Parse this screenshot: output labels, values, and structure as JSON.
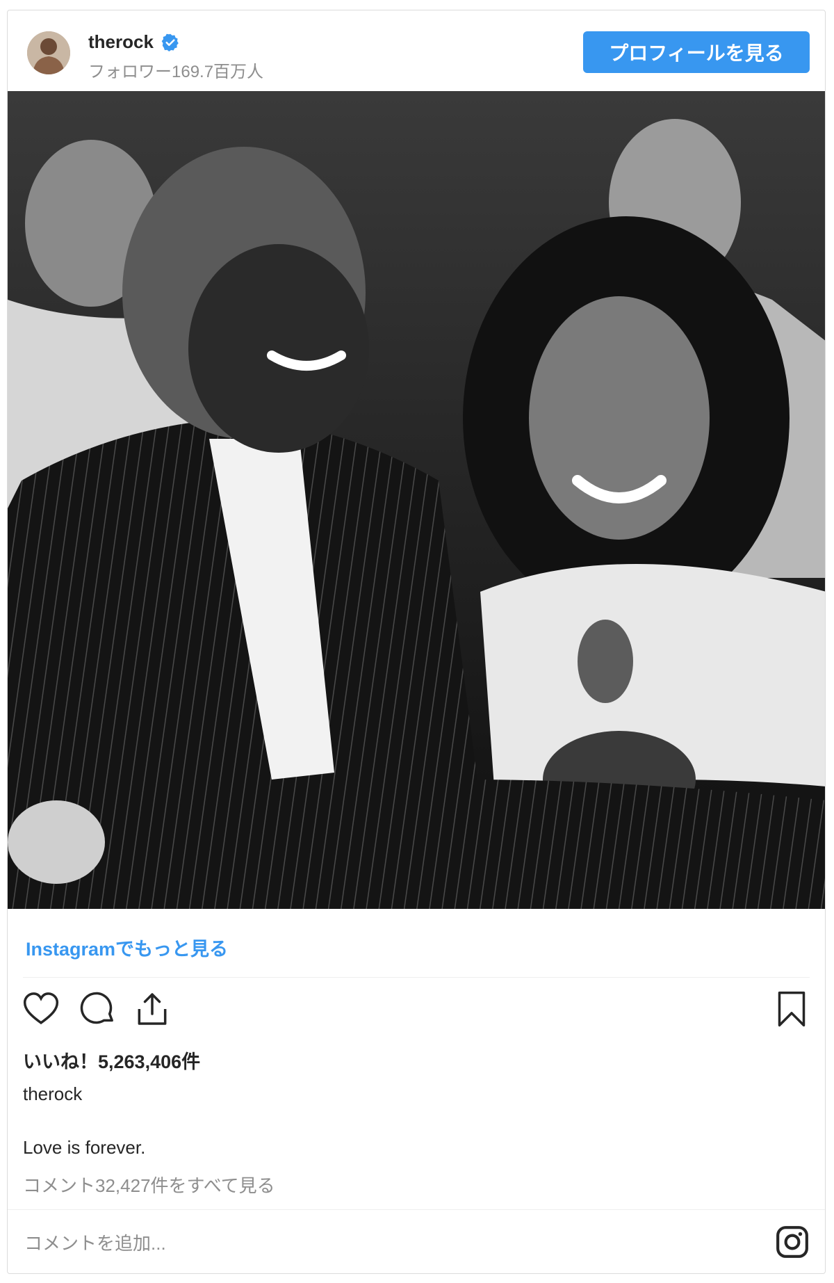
{
  "post": {
    "username": "therock",
    "followers": "フォロワー169.7百万人",
    "profile_button": "プロフィールを見る",
    "more_on_instagram": "Instagramでもっと見る",
    "likes": "いいね！5,263,406件",
    "caption_user": "therock",
    "caption": "Love is forever.",
    "view_comments": "コメント32,427件をすべて見る",
    "comment_placeholder": "コメントを追加..."
  },
  "icons": {
    "verified": "verified-badge-icon",
    "like": "heart-icon",
    "comment": "comment-bubble-icon",
    "share": "share-icon",
    "save": "bookmark-icon",
    "brand": "instagram-icon"
  },
  "colors": {
    "accent": "#3897f0",
    "text": "#262626",
    "muted": "#8e8e8e",
    "border": "#dbdbdb"
  }
}
